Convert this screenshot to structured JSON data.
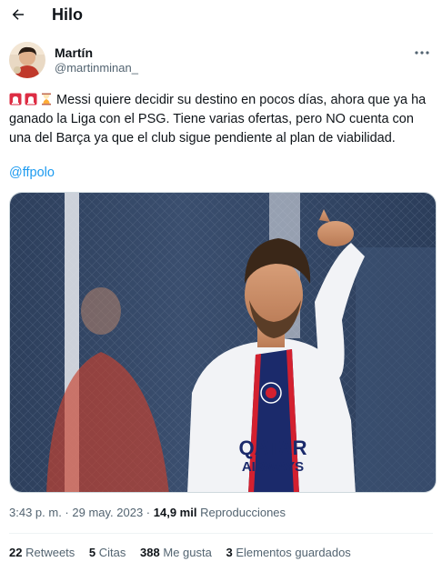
{
  "header": {
    "title": "Hilo",
    "back_icon": "arrow-left-icon"
  },
  "author": {
    "name": "Martín",
    "handle": "@martinminan_",
    "more_icon": "more-horizontal-icon"
  },
  "tweet": {
    "emojis": [
      "rotating-light-icon",
      "rotating-light-icon",
      "hourglass-icon"
    ],
    "text": "Messi quiere decidir su destino en pocos días, ahora que ya ha ganado la Liga con el PSG. Tiene varias ofertas, pero NO cuenta con una del Barça ya que el club sigue pendiente al plan de viabilidad.",
    "mention": "@ffpolo"
  },
  "meta": {
    "time": "3:43 p. m.",
    "separator": " · ",
    "date": "29 may. 2023",
    "views_count": "14,9 mil",
    "views_label": "Reproducciones"
  },
  "stats": {
    "retweets_count": "22",
    "retweets_label": "Retweets",
    "quotes_count": "5",
    "quotes_label": "Citas",
    "likes_count": "388",
    "likes_label": "Me gusta",
    "bookmarks_count": "3",
    "bookmarks_label": "Elementos guardados"
  },
  "media": {
    "jersey_sponsor_line1": "QATAR",
    "jersey_sponsor_line2": "AIRWAYS"
  },
  "colors": {
    "link": "#1d9bf0",
    "secondary_text": "#536471",
    "psg_navy": "#1b2a6b",
    "psg_red": "#d3202f"
  }
}
